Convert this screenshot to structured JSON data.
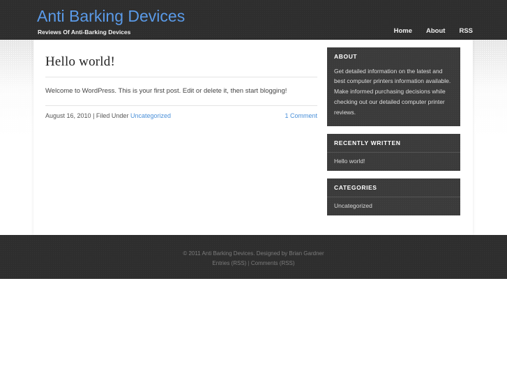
{
  "site": {
    "title": "Anti Barking Devices",
    "description": "Reviews Of Anti-Barking Devices"
  },
  "nav": {
    "items": [
      {
        "label": "Home"
      },
      {
        "label": "About"
      },
      {
        "label": "RSS"
      }
    ]
  },
  "post": {
    "title": "Hello world!",
    "body": "Welcome to WordPress. This is your first post. Edit or delete it, then start blogging!",
    "date": "August 16, 2010",
    "filed_under_label": "| Filed Under",
    "category": "Uncategorized",
    "comments": "1 Comment"
  },
  "sidebar": {
    "about": {
      "title": "ABOUT",
      "text": "Get detailed information on the latest and best computer printers information available. Make informed purchasing decisions while checking out our detailed computer printer reviews."
    },
    "recent": {
      "title": "RECENTLY WRITTEN",
      "items": [
        {
          "label": "Hello world!"
        }
      ]
    },
    "categories": {
      "title": "CATEGORIES",
      "items": [
        {
          "label": "Uncategorized"
        }
      ]
    }
  },
  "footer": {
    "copyright": "© 2011 Anti Barking Devices. Designed by Brian Gardner",
    "entries_rss": "Entries (RSS)",
    "separator": "|",
    "comments_rss": "Comments (RSS)"
  },
  "colors": {
    "accent_blue": "#5a9ae8",
    "link_blue": "#4a90d9",
    "dark_band": "#2e2e2e",
    "widget_bg": "#3b3b3b"
  }
}
